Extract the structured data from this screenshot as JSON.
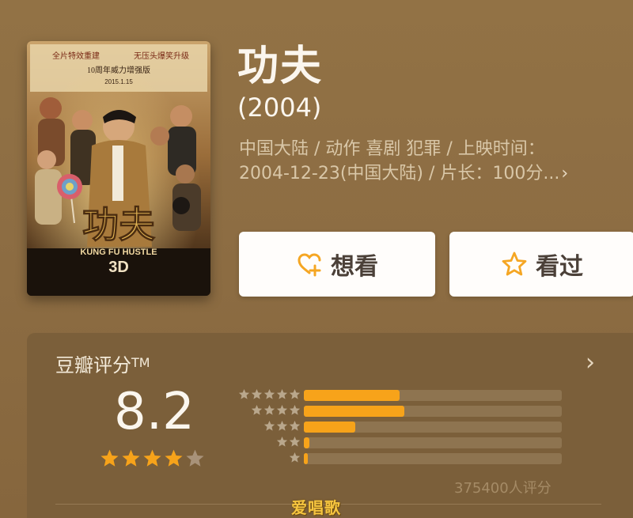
{
  "movie": {
    "title": "功夫",
    "year": "(2004)",
    "meta_line1": "中国大陆 / 动作 喜剧 犯罪 / 上映时间：",
    "meta_line2": "2004-12-23(中国大陆) / 片长：100分...",
    "meta_more_icon": "chevron-right-icon"
  },
  "poster": {
    "top_text_left": "全片特效重建",
    "top_text_right": "无压头爆笑升级",
    "sub_text": "10周年威力增强版",
    "date_text": "2015.1.15",
    "logo_cn": "功夫",
    "logo_en": "KUNG FU HUSTLE",
    "logo_3d": "3D"
  },
  "actions": {
    "want_label": "想看",
    "want_icon": "heart-plus-icon",
    "seen_label": "看过",
    "seen_icon": "star-outline-icon",
    "accent": "#f5a623"
  },
  "rating": {
    "title": "豆瓣评分",
    "trademark": "TM",
    "score": "8.2",
    "stars_filled": 4,
    "stars_total": 5,
    "count_text": "375400人评分",
    "distribution": [
      {
        "stars": 5,
        "fraction": 0.37
      },
      {
        "stars": 4,
        "fraction": 0.39
      },
      {
        "stars": 3,
        "fraction": 0.2
      },
      {
        "stars": 2,
        "fraction": 0.02
      },
      {
        "stars": 1,
        "fraction": 0.005
      }
    ],
    "bar_color": "#f7a31a",
    "star_color": "#f7a31a"
  },
  "watermark": "爱唱歌"
}
